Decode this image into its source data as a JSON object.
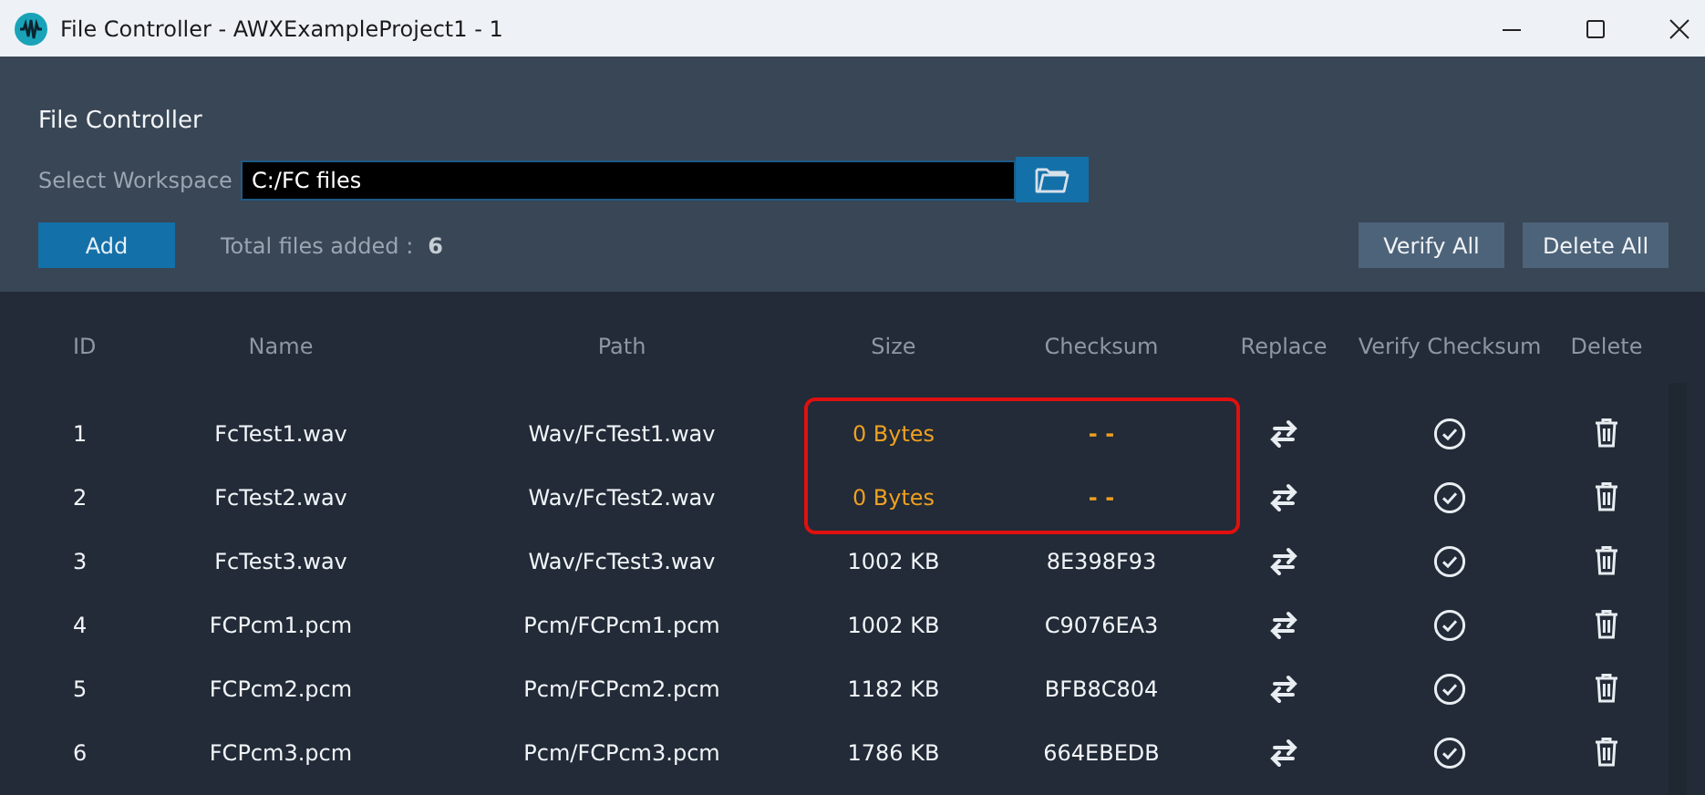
{
  "window": {
    "title": "File Controller - AWXExampleProject1 - 1"
  },
  "header": {
    "title": "File Controller",
    "workspace_label": "Select Workspace",
    "workspace_value": "C:/FC files",
    "add_button": "Add",
    "total_label": "Total files added :",
    "total_value": "6",
    "buttons": [
      "Verify All",
      "Delete All"
    ]
  },
  "table": {
    "columns": [
      "ID",
      "Name",
      "Path",
      "Size",
      "Checksum",
      "Replace",
      "Verify Checksum",
      "Delete"
    ],
    "rows": [
      {
        "id": "1",
        "name": "FcTest1.wav",
        "path": "Wav/FcTest1.wav",
        "size": "0 Bytes",
        "checksum": "- -",
        "flagged": true
      },
      {
        "id": "2",
        "name": "FcTest2.wav",
        "path": "Wav/FcTest2.wav",
        "size": "0 Bytes",
        "checksum": "- -",
        "flagged": true
      },
      {
        "id": "3",
        "name": "FcTest3.wav",
        "path": "Wav/FcTest3.wav",
        "size": "1002 KB",
        "checksum": "8E398F93",
        "flagged": false
      },
      {
        "id": "4",
        "name": "FCPcm1.pcm",
        "path": "Pcm/FCPcm1.pcm",
        "size": "1002 KB",
        "checksum": "C9076EA3",
        "flagged": false
      },
      {
        "id": "5",
        "name": "FCPcm2.pcm",
        "path": "Pcm/FCPcm2.pcm",
        "size": "1182 KB",
        "checksum": "BFB8C804",
        "flagged": false
      },
      {
        "id": "6",
        "name": "FCPcm3.pcm",
        "path": "Pcm/FCPcm3.pcm",
        "size": "1786 KB",
        "checksum": "664EBEDB",
        "flagged": false
      }
    ]
  }
}
